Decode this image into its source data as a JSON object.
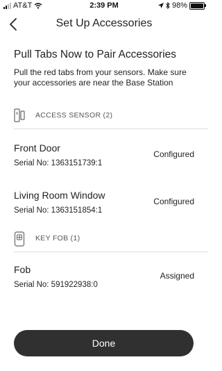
{
  "status_bar": {
    "carrier": "AT&T",
    "time": "2:39 PM",
    "battery": "98%",
    "battery_level": 0.98,
    "icons": [
      "signal-icon",
      "wifi-icon",
      "location-arrow-icon",
      "bluetooth-icon",
      "battery-icon"
    ]
  },
  "header": {
    "title": "Set Up Accessories",
    "back_icon": "chevron-left-icon"
  },
  "intro": {
    "title": "Pull Tabs Now to Pair Accessories",
    "text": "Pull the red tabs from your sensors. Make sure your accessories are near the Base Station"
  },
  "sections": [
    {
      "label": "ACCESS SENSOR (2)",
      "icon": "access-sensor-icon",
      "items": [
        {
          "name": "Front Door",
          "serial": "Serial No: 1363151739:1",
          "status": "Configured"
        },
        {
          "name": "Living Room Window",
          "serial": "Serial No: 1363151854:1",
          "status": "Configured"
        }
      ]
    },
    {
      "label": "KEY FOB (1)",
      "icon": "key-fob-icon",
      "items": [
        {
          "name": "Fob",
          "serial": "Serial No: 591922938:0",
          "status": "Assigned"
        }
      ]
    }
  ],
  "footer": {
    "done_label": "Done"
  }
}
